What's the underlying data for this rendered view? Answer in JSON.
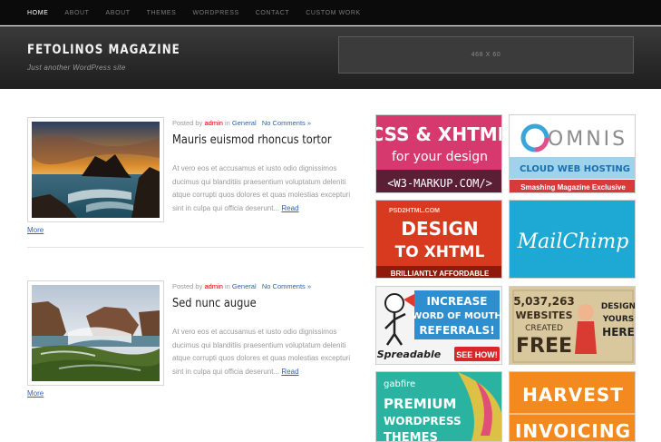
{
  "nav": {
    "items": [
      {
        "label": "HOME",
        "active": true
      },
      {
        "label": "ABOUT",
        "active": false
      },
      {
        "label": "ABOUT",
        "active": false
      },
      {
        "label": "THEMES",
        "active": false
      },
      {
        "label": "WORDPRESS",
        "active": false
      },
      {
        "label": "CONTACT",
        "active": false
      },
      {
        "label": "CUSTOM WORK",
        "active": false
      }
    ]
  },
  "header": {
    "title": "FETOLINOS MAGAZINE",
    "tagline": "Just another WordPress site",
    "ad_placeholder": "468 X 60"
  },
  "posts": [
    {
      "posted_by": "Posted by",
      "author": "admin",
      "in": "in",
      "category": "General",
      "comments": "No Comments »",
      "title": "Mauris euismod rhoncus tortor",
      "excerpt": "At vero eos et accusamus et iusto odio dignissimos ducimus qui blanditiis praesentium voluptatum deleniti atque corrupti quos dolores et quas molestias excepturi sint in culpa qui officia deserunt...",
      "read": "Read",
      "more": "More"
    },
    {
      "posted_by": "Posted by",
      "author": "admin",
      "in": "in",
      "category": "General",
      "comments": "No Comments »",
      "title": "Sed nunc augue",
      "excerpt": "At vero eos et accusamus et iusto odio dignissimos ducimus qui blanditiis praesentium voluptatum deleniti atque corrupti quos dolores et quas molestias excepturi sint in culpa qui officia deserunt...",
      "read": "Read",
      "more": "More"
    }
  ],
  "ads": {
    "css_xhtml": {
      "line1": "CSS & XHTML",
      "line2": "for your design",
      "line3": "<W3-MARKUP.COM/>"
    },
    "omnis": {
      "brand": "OMNIS",
      "line1": "CLOUD WEB HOSTING",
      "line2": "Smashing Magazine Exclusive"
    },
    "psd2html": {
      "site": "PSD2HTML.COM",
      "line1": "DESIGN",
      "line2": "TO XHTML",
      "line3": "BRILLIANTLY AFFORDABLE"
    },
    "mailchimp": {
      "brand": "MailChimp"
    },
    "spreadable": {
      "line1": "INCREASE",
      "line2": "WORD OF MOUTH",
      "line3": "REFERRALS!",
      "brand": "Spreadable",
      "cta": "SEE HOW!"
    },
    "websites": {
      "count": "5,037,263",
      "line1": "WEBSITES",
      "line2": "CREATED",
      "line3": "FREE",
      "side1": "DESIGN",
      "side2": "YOURS",
      "side3": "HERE"
    },
    "gabfire": {
      "brand": "gabfire",
      "line1": "PREMIUM",
      "line2": "WORDPRESS",
      "line3": "THEMES"
    },
    "harvest": {
      "line1": "HARVEST",
      "line2": "INVOICING"
    }
  },
  "colors": {
    "link": "#2a64b5",
    "author": "#cc0000",
    "nav_bg": "#0b0b0b",
    "header_bg": "#2e2e2e"
  }
}
